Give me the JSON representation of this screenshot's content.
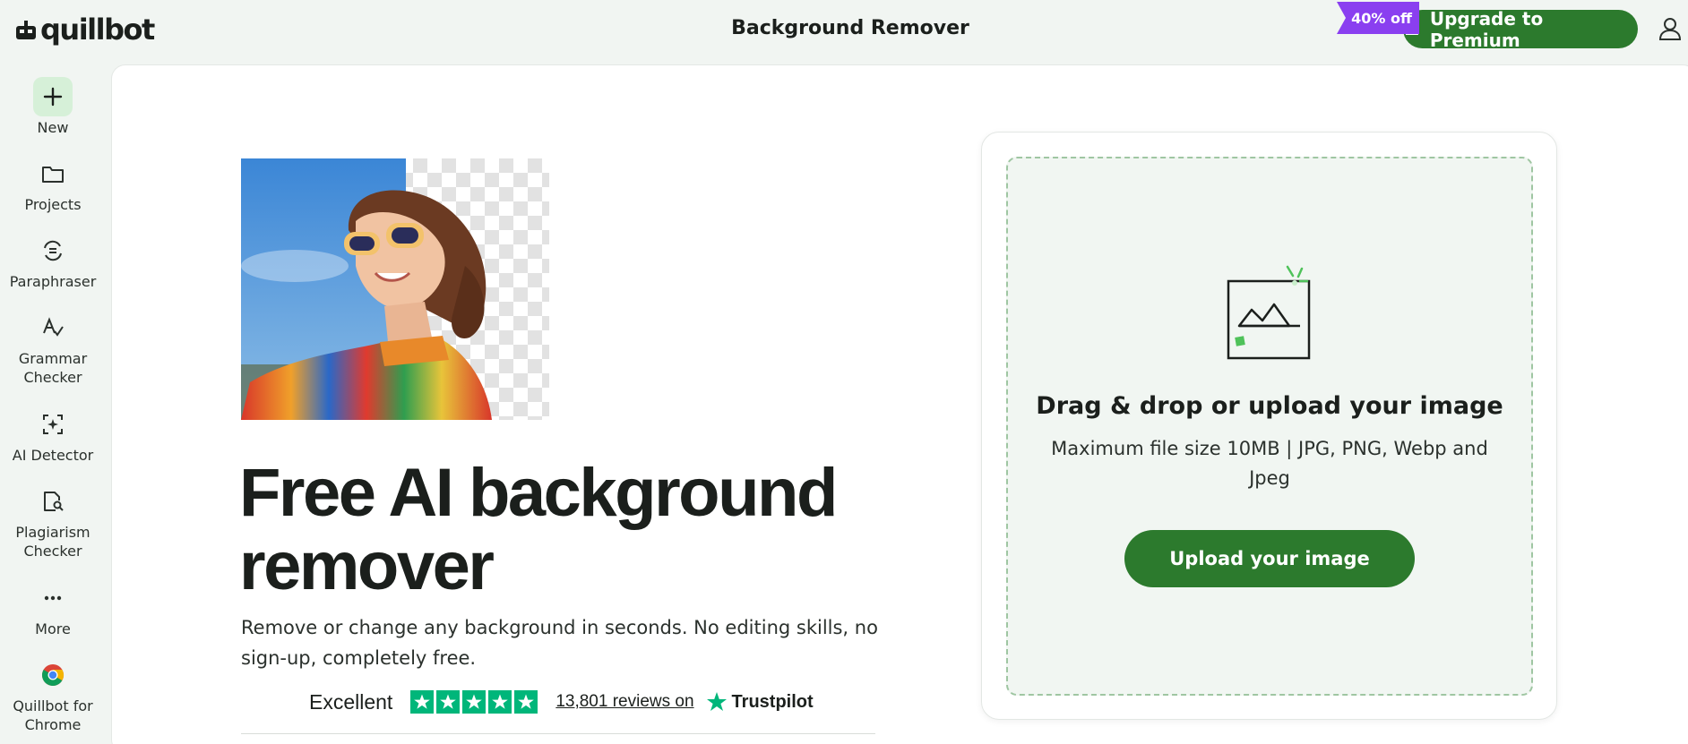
{
  "header": {
    "logo_text": "quillbot",
    "page_title": "Background Remover",
    "discount_badge": "40% off",
    "upgrade_label": "Upgrade to Premium"
  },
  "sidebar": {
    "items": [
      {
        "label": "New",
        "icon": "plus-icon"
      },
      {
        "label": "Projects",
        "icon": "folder-icon"
      },
      {
        "label": "Paraphraser",
        "icon": "paraphraser-icon"
      },
      {
        "label": "Grammar Checker",
        "icon": "grammar-icon"
      },
      {
        "label": "AI Detector",
        "icon": "ai-detector-icon"
      },
      {
        "label": "Plagiarism Checker",
        "icon": "plagiarism-icon"
      },
      {
        "label": "More",
        "icon": "more-icon"
      },
      {
        "label": "Quillbot for Chrome",
        "icon": "chrome-icon"
      }
    ]
  },
  "hero": {
    "headline": "Free AI background remover",
    "subtext": "Remove or change any background in seconds. No editing skills, no sign-up, completely free.",
    "rating_label": "Excellent",
    "stars": 5,
    "reviews_link": "13,801 reviews on",
    "trustpilot": "Trustpilot"
  },
  "upload": {
    "title": "Drag & drop or upload your image",
    "subtitle": "Maximum file size 10MB | JPG, PNG, Webp and Jpeg",
    "button_label": "Upload your image"
  },
  "colors": {
    "brand_green": "#2c7a2d",
    "badge_purple": "#8a3ff0",
    "trustpilot_green": "#00b67a"
  }
}
